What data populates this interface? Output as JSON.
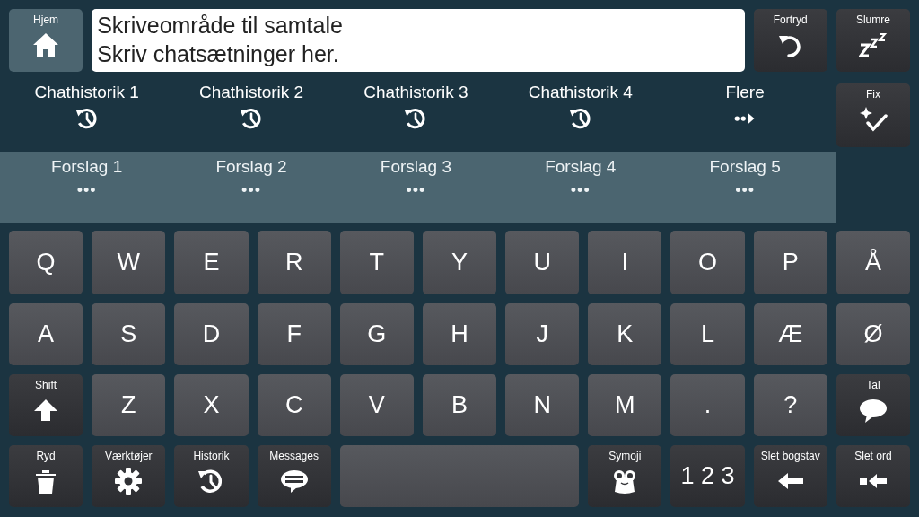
{
  "top_bar": {
    "home_button": {
      "label": "Hjem",
      "kind": "home"
    },
    "text_area": {
      "lines": [
        "Skriveområde til samtale",
        "Skriv chatsætninger her."
      ]
    },
    "buttons": [
      {
        "label": "Fortryd",
        "kind": "undo"
      },
      {
        "label": "Slumre",
        "kind": "snooze"
      }
    ]
  },
  "chat_history": [
    {
      "label": "Chathistorik 1",
      "kind": "history"
    },
    {
      "label": "Chathistorik 2",
      "kind": "history"
    },
    {
      "label": "Chathistorik 3",
      "kind": "history"
    },
    {
      "label": "Chathistorik 4",
      "kind": "history"
    },
    {
      "label": "Flere",
      "kind": "more"
    }
  ],
  "fix_button": {
    "label": "Fix",
    "kind": "fix"
  },
  "suggestions": [
    {
      "label": "Forslag 1",
      "dots": "•••"
    },
    {
      "label": "Forslag 2",
      "dots": "•••"
    },
    {
      "label": "Forslag 3",
      "dots": "•••"
    },
    {
      "label": "Forslag 4",
      "dots": "•••"
    },
    {
      "label": "Forslag 5",
      "dots": "•••"
    }
  ],
  "keyboard": {
    "rows": [
      [
        {
          "kind": "letter",
          "label": "Q"
        },
        {
          "kind": "letter",
          "label": "W"
        },
        {
          "kind": "letter",
          "label": "E"
        },
        {
          "kind": "letter",
          "label": "R"
        },
        {
          "kind": "letter",
          "label": "T"
        },
        {
          "kind": "letter",
          "label": "Y"
        },
        {
          "kind": "letter",
          "label": "U"
        },
        {
          "kind": "letter",
          "label": "I"
        },
        {
          "kind": "letter",
          "label": "O"
        },
        {
          "kind": "letter",
          "label": "P"
        },
        {
          "kind": "letter",
          "label": "Å"
        }
      ],
      [
        {
          "kind": "letter",
          "label": "A"
        },
        {
          "kind": "letter",
          "label": "S"
        },
        {
          "kind": "letter",
          "label": "D"
        },
        {
          "kind": "letter",
          "label": "F"
        },
        {
          "kind": "letter",
          "label": "G"
        },
        {
          "kind": "letter",
          "label": "H"
        },
        {
          "kind": "letter",
          "label": "J"
        },
        {
          "kind": "letter",
          "label": "K"
        },
        {
          "kind": "letter",
          "label": "L"
        },
        {
          "kind": "letter",
          "label": "Æ"
        },
        {
          "kind": "letter",
          "label": "Ø"
        }
      ],
      [
        {
          "kind": "shift",
          "label": "Shift"
        },
        {
          "kind": "letter",
          "label": "Z"
        },
        {
          "kind": "letter",
          "label": "X"
        },
        {
          "kind": "letter",
          "label": "C"
        },
        {
          "kind": "letter",
          "label": "V"
        },
        {
          "kind": "letter",
          "label": "B"
        },
        {
          "kind": "letter",
          "label": "N"
        },
        {
          "kind": "letter",
          "label": "M"
        },
        {
          "kind": "letter",
          "label": "."
        },
        {
          "kind": "letter",
          "label": "?"
        },
        {
          "kind": "speak",
          "label": "Tal"
        }
      ],
      [
        {
          "kind": "clear",
          "label": "Ryd"
        },
        {
          "kind": "tools",
          "label": "Værktøjer"
        },
        {
          "kind": "history",
          "label": "Historik"
        },
        {
          "kind": "messages",
          "label": "Messages"
        },
        {
          "kind": "space"
        },
        "",
        "",
        {
          "kind": "symoji",
          "label": "Symoji"
        },
        {
          "kind": "numbers",
          "label": "1 2 3"
        },
        {
          "kind": "backspace",
          "label": "Slet bogstav"
        },
        {
          "kind": "delete-word",
          "label": "Slet ord"
        }
      ]
    ]
  }
}
